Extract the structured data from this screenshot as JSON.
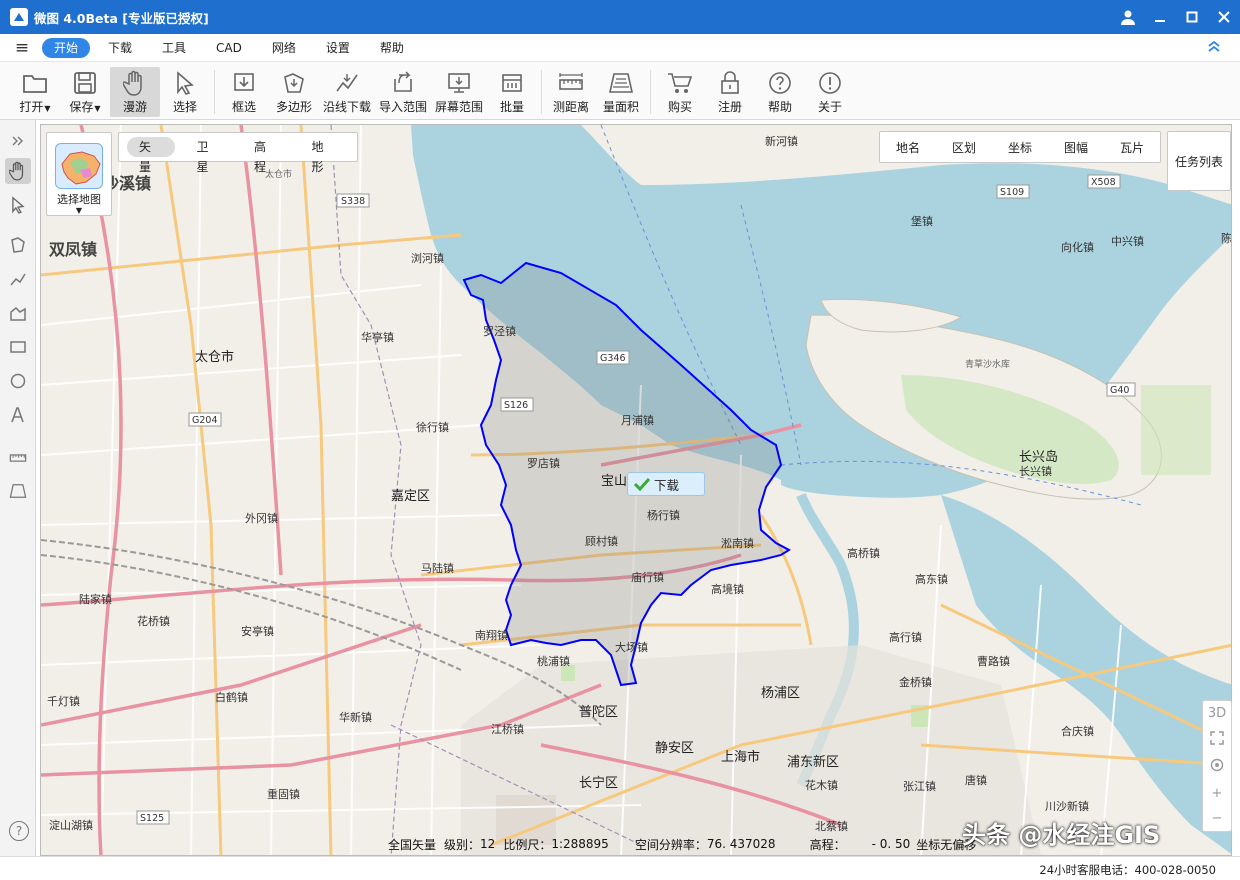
{
  "window": {
    "title": "微图 4.0Beta [专业版已授权]"
  },
  "menu": {
    "items": [
      "开始",
      "下载",
      "工具",
      "CAD",
      "网络",
      "设置",
      "帮助"
    ]
  },
  "toolbar": {
    "open": "打开",
    "save": "保存",
    "pan": "漫游",
    "select": "选择",
    "rect_select": "框选",
    "polygon": "多边形",
    "line_download": "沿线下载",
    "import_range": "导入范围",
    "screen_range": "屏幕范围",
    "batch": "批量",
    "measure_distance": "测距离",
    "measure_area": "量面积",
    "buy": "购买",
    "register": "注册",
    "help": "帮助",
    "about": "关于"
  },
  "map_controls": {
    "select_map": "选择地图",
    "map_types": [
      "矢量",
      "卫星",
      "高程",
      "地形"
    ],
    "layers": [
      "地名",
      "区划",
      "坐标",
      "图幅",
      "瓦片"
    ],
    "task_list": "任务列表",
    "download_badge": "下载",
    "view_3d": "3D"
  },
  "map": {
    "selected_district": "宝山区",
    "place_labels": [
      {
        "text": "沙溪镇",
        "cls": "huge"
      },
      {
        "text": "双凤镇",
        "cls": "huge"
      },
      {
        "text": "太仓市",
        "cls": "big"
      },
      {
        "text": "嘉定区",
        "cls": "big"
      },
      {
        "text": "宝山区",
        "cls": "big"
      },
      {
        "text": "杨浦区",
        "cls": "big"
      },
      {
        "text": "普陀区",
        "cls": "big"
      },
      {
        "text": "静安区",
        "cls": "big"
      },
      {
        "text": "上海市",
        "cls": "big"
      },
      {
        "text": "浦东新区",
        "cls": "big"
      },
      {
        "text": "长宁区",
        "cls": "big"
      },
      {
        "text": "长兴岛",
        "cls": "big"
      },
      {
        "text": "浏河镇",
        "cls": ""
      },
      {
        "text": "罗泾镇",
        "cls": ""
      },
      {
        "text": "华亭镇",
        "cls": ""
      },
      {
        "text": "月浦镇",
        "cls": ""
      },
      {
        "text": "徐行镇",
        "cls": ""
      },
      {
        "text": "罗店镇",
        "cls": ""
      },
      {
        "text": "外冈镇",
        "cls": ""
      },
      {
        "text": "杨行镇",
        "cls": ""
      },
      {
        "text": "淞南镇",
        "cls": ""
      },
      {
        "text": "顾村镇",
        "cls": ""
      },
      {
        "text": "马陆镇",
        "cls": ""
      },
      {
        "text": "庙行镇",
        "cls": ""
      },
      {
        "text": "高境镇",
        "cls": ""
      },
      {
        "text": "陆家镇",
        "cls": ""
      },
      {
        "text": "花桥镇",
        "cls": ""
      },
      {
        "text": "安亭镇",
        "cls": ""
      },
      {
        "text": "南翔镇",
        "cls": ""
      },
      {
        "text": "大场镇",
        "cls": ""
      },
      {
        "text": "桃浦镇",
        "cls": ""
      },
      {
        "text": "千灯镇",
        "cls": ""
      },
      {
        "text": "白鹤镇",
        "cls": ""
      },
      {
        "text": "华新镇",
        "cls": ""
      },
      {
        "text": "江桥镇",
        "cls": ""
      },
      {
        "text": "重固镇",
        "cls": ""
      },
      {
        "text": "淀山湖镇",
        "cls": ""
      },
      {
        "text": "新河镇",
        "cls": ""
      },
      {
        "text": "堡镇",
        "cls": ""
      },
      {
        "text": "向化镇",
        "cls": ""
      },
      {
        "text": "中兴镇",
        "cls": ""
      },
      {
        "text": "陈家",
        "cls": ""
      },
      {
        "text": "长兴镇",
        "cls": ""
      },
      {
        "text": "高桥镇",
        "cls": ""
      },
      {
        "text": "高东镇",
        "cls": ""
      },
      {
        "text": "高行镇",
        "cls": ""
      },
      {
        "text": "曹路镇",
        "cls": ""
      },
      {
        "text": "金桥镇",
        "cls": ""
      },
      {
        "text": "合庆镇",
        "cls": ""
      },
      {
        "text": "唐镇",
        "cls": ""
      },
      {
        "text": "张江镇",
        "cls": ""
      },
      {
        "text": "川沙新镇",
        "cls": ""
      },
      {
        "text": "花木镇",
        "cls": ""
      },
      {
        "text": "北蔡镇",
        "cls": ""
      },
      {
        "text": "太仓市",
        "cls": "small"
      },
      {
        "text": "青草沙水库",
        "cls": "small"
      }
    ],
    "road_shields": [
      "S338",
      "S109",
      "X508",
      "G346",
      "S126",
      "G204",
      "G40",
      "S125"
    ]
  },
  "status": {
    "scope_label": "全国矢量",
    "level_label": "级别：",
    "level": "12",
    "scale_label": "比例尺：",
    "scale": "1:288895",
    "resolution_label": "空间分辨率：",
    "resolution": "76. 437028",
    "elevation_label": "高程：",
    "elevation": "- 0. 50",
    "offset_text": "坐标无偏移"
  },
  "footer": {
    "phone": "24小时客服电话：400-028-0050"
  },
  "watermark": "头条 @水经注GIS",
  "colors": {
    "titlebar": "#1f6fce",
    "accent": "#2f86e6",
    "water": "#aad3df",
    "boundary": "#0000ff"
  }
}
